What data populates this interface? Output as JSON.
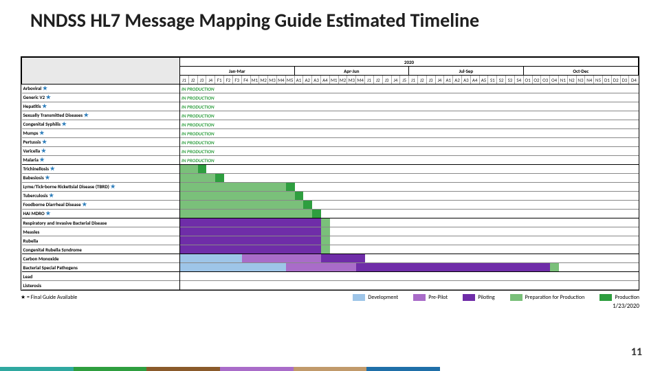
{
  "title": "NNDSS HL7 Message Mapping Guide Estimated Timeline",
  "year_label": "2020",
  "quarters": [
    "Jan-Mar",
    "Apr-Jun",
    "Jul-Sep",
    "Oct-Dec"
  ],
  "weeks": [
    "J1",
    "J2",
    "J3",
    "J4",
    "F1",
    "F2",
    "F3",
    "F4",
    "M1",
    "M2",
    "M3",
    "M4",
    "M5",
    "A1",
    "A2",
    "A3",
    "A4",
    "M1",
    "M2",
    "M3",
    "M4",
    "J1",
    "J2",
    "J3",
    "J4",
    "J5",
    "J1",
    "J2",
    "J3",
    "J4",
    "A1",
    "A2",
    "A3",
    "A4",
    "A5",
    "S1",
    "S2",
    "S3",
    "S4",
    "O1",
    "O2",
    "O3",
    "O4",
    "N1",
    "N2",
    "N3",
    "N4",
    "N5",
    "D1",
    "D2",
    "D3",
    "D4"
  ],
  "star_glyph": "★",
  "in_production_label": "IN PRODUCTION",
  "conditions": [
    {
      "name": "Arboviral",
      "star": true,
      "in_production": true,
      "bars": [],
      "sep": false
    },
    {
      "name": "Generic V2",
      "star": true,
      "in_production": true,
      "bars": [],
      "sep": false
    },
    {
      "name": "Hepatitis",
      "star": true,
      "in_production": true,
      "bars": [],
      "sep": false
    },
    {
      "name": "Sexually Transmitted Diseases",
      "star": true,
      "in_production": true,
      "bars": [],
      "sep": false
    },
    {
      "name": "Congenital Syphilis",
      "star": true,
      "in_production": true,
      "bars": [],
      "sep": false
    },
    {
      "name": "Mumps",
      "star": true,
      "in_production": true,
      "bars": [],
      "sep": false
    },
    {
      "name": "Pertussis",
      "star": true,
      "in_production": true,
      "bars": [],
      "sep": false
    },
    {
      "name": "Varicella",
      "star": true,
      "in_production": true,
      "bars": [],
      "sep": false
    },
    {
      "name": "Malaria",
      "star": true,
      "in_production": true,
      "bars": [],
      "sep": true
    },
    {
      "name": "Trichinellosis",
      "star": true,
      "in_production": false,
      "bars": [
        {
          "phase": "prep",
          "start": 0,
          "end": 2
        },
        {
          "phase": "prod",
          "start": 2,
          "end": 3
        }
      ],
      "sep": false
    },
    {
      "name": "Babesiosis",
      "star": true,
      "in_production": false,
      "bars": [
        {
          "phase": "prep",
          "start": 0,
          "end": 4
        },
        {
          "phase": "prod",
          "start": 4,
          "end": 5
        }
      ],
      "sep": false
    },
    {
      "name": "Lyme/Tick-borne Rickettsial Disease (TBRD)",
      "star": true,
      "in_production": false,
      "bars": [
        {
          "phase": "prep",
          "start": 0,
          "end": 12
        },
        {
          "phase": "prod",
          "start": 12,
          "end": 13
        }
      ],
      "sep": false
    },
    {
      "name": "Tuberculosis",
      "star": true,
      "in_production": false,
      "bars": [
        {
          "phase": "prep",
          "start": 0,
          "end": 13
        },
        {
          "phase": "prod",
          "start": 13,
          "end": 14
        }
      ],
      "sep": false
    },
    {
      "name": "Foodborne Diarrheal Disease",
      "star": true,
      "in_production": false,
      "bars": [
        {
          "phase": "prep",
          "start": 0,
          "end": 14
        },
        {
          "phase": "prod",
          "start": 14,
          "end": 15
        }
      ],
      "sep": false
    },
    {
      "name": "HAI MDRO",
      "star": true,
      "in_production": false,
      "bars": [
        {
          "phase": "prep",
          "start": 0,
          "end": 15
        },
        {
          "phase": "prod",
          "start": 15,
          "end": 16
        }
      ],
      "sep": true
    },
    {
      "name": "Respiratory and Invasive Bacterial Disease",
      "star": false,
      "in_production": false,
      "bars": [
        {
          "phase": "pilot",
          "start": 0,
          "end": 16
        },
        {
          "phase": "prep",
          "start": 16,
          "end": 17
        }
      ],
      "sep": false
    },
    {
      "name": "Measles",
      "star": false,
      "in_production": false,
      "bars": [
        {
          "phase": "pilot",
          "start": 0,
          "end": 16
        },
        {
          "phase": "prep",
          "start": 16,
          "end": 17
        }
      ],
      "sep": false
    },
    {
      "name": "Rubella",
      "star": false,
      "in_production": false,
      "bars": [
        {
          "phase": "pilot",
          "start": 0,
          "end": 16
        },
        {
          "phase": "prep",
          "start": 16,
          "end": 17
        }
      ],
      "sep": false
    },
    {
      "name": "Congenital Rubella Syndrome",
      "star": false,
      "in_production": false,
      "bars": [
        {
          "phase": "pilot",
          "start": 0,
          "end": 16
        },
        {
          "phase": "prep",
          "start": 16,
          "end": 17
        }
      ],
      "sep": true
    },
    {
      "name": "Carbon Monoxide",
      "star": false,
      "in_production": false,
      "bars": [
        {
          "phase": "dev",
          "start": 0,
          "end": 7
        },
        {
          "phase": "pre",
          "start": 7,
          "end": 16
        },
        {
          "phase": "pilot",
          "start": 16,
          "end": 21
        }
      ],
      "sep": false
    },
    {
      "name": "Bacterial Special Pathogens",
      "star": false,
      "in_production": false,
      "bars": [
        {
          "phase": "dev",
          "start": 0,
          "end": 12
        },
        {
          "phase": "pre",
          "start": 12,
          "end": 20
        },
        {
          "phase": "pilot",
          "start": 20,
          "end": 42
        },
        {
          "phase": "prep",
          "start": 42,
          "end": 43
        }
      ],
      "sep": true
    },
    {
      "name": "Lead",
      "star": false,
      "in_production": false,
      "bars": [],
      "sep": false
    },
    {
      "name": "Listerosis",
      "star": false,
      "in_production": false,
      "bars": [],
      "sep": false
    }
  ],
  "legend": {
    "note": "★ = Final Guide Available",
    "items": [
      {
        "label": "Development",
        "cls": "c-dev"
      },
      {
        "label": "Pre-Pilot",
        "cls": "c-pre"
      },
      {
        "label": "Piloting",
        "cls": "c-pilot"
      },
      {
        "label": "Preparation for Production",
        "cls": "c-prep"
      },
      {
        "label": "Production",
        "cls": "c-prod"
      }
    ]
  },
  "as_of_date": "1/23/2020",
  "page_number": "11",
  "footer_colors": [
    "#2fa8a0",
    "#2e9e3f",
    "#8a5a2b",
    "#a96cc9",
    "#c19a6b",
    "#1f6fa8"
  ],
  "chart_data": {
    "type": "gantt",
    "title": "NNDSS HL7 Message Mapping Guide Estimated Timeline",
    "x_unit": "week_of_2020",
    "x_range": [
      0,
      52
    ],
    "phases": [
      "Development",
      "Pre-Pilot",
      "Piloting",
      "Preparation for Production",
      "Production",
      "In Production (prior)"
    ],
    "series": [
      {
        "name": "Arboviral",
        "segments": [
          [
            "In Production (prior)",
            0,
            0
          ]
        ]
      },
      {
        "name": "Generic V2",
        "segments": [
          [
            "In Production (prior)",
            0,
            0
          ]
        ]
      },
      {
        "name": "Hepatitis",
        "segments": [
          [
            "In Production (prior)",
            0,
            0
          ]
        ]
      },
      {
        "name": "Sexually Transmitted Diseases",
        "segments": [
          [
            "In Production (prior)",
            0,
            0
          ]
        ]
      },
      {
        "name": "Congenital Syphilis",
        "segments": [
          [
            "In Production (prior)",
            0,
            0
          ]
        ]
      },
      {
        "name": "Mumps",
        "segments": [
          [
            "In Production (prior)",
            0,
            0
          ]
        ]
      },
      {
        "name": "Pertussis",
        "segments": [
          [
            "In Production (prior)",
            0,
            0
          ]
        ]
      },
      {
        "name": "Varicella",
        "segments": [
          [
            "In Production (prior)",
            0,
            0
          ]
        ]
      },
      {
        "name": "Malaria",
        "segments": [
          [
            "In Production (prior)",
            0,
            0
          ]
        ]
      },
      {
        "name": "Trichinellosis",
        "segments": [
          [
            "Preparation for Production",
            0,
            2
          ],
          [
            "Production",
            2,
            3
          ]
        ]
      },
      {
        "name": "Babesiosis",
        "segments": [
          [
            "Preparation for Production",
            0,
            4
          ],
          [
            "Production",
            4,
            5
          ]
        ]
      },
      {
        "name": "Lyme/Tick-borne Rickettsial Disease (TBRD)",
        "segments": [
          [
            "Preparation for Production",
            0,
            12
          ],
          [
            "Production",
            12,
            13
          ]
        ]
      },
      {
        "name": "Tuberculosis",
        "segments": [
          [
            "Preparation for Production",
            0,
            13
          ],
          [
            "Production",
            13,
            14
          ]
        ]
      },
      {
        "name": "Foodborne Diarrheal Disease",
        "segments": [
          [
            "Preparation for Production",
            0,
            14
          ],
          [
            "Production",
            14,
            15
          ]
        ]
      },
      {
        "name": "HAI MDRO",
        "segments": [
          [
            "Preparation for Production",
            0,
            15
          ],
          [
            "Production",
            15,
            16
          ]
        ]
      },
      {
        "name": "Respiratory and Invasive Bacterial Disease",
        "segments": [
          [
            "Piloting",
            0,
            16
          ],
          [
            "Preparation for Production",
            16,
            17
          ]
        ]
      },
      {
        "name": "Measles",
        "segments": [
          [
            "Piloting",
            0,
            16
          ],
          [
            "Preparation for Production",
            16,
            17
          ]
        ]
      },
      {
        "name": "Rubella",
        "segments": [
          [
            "Piloting",
            0,
            16
          ],
          [
            "Preparation for Production",
            16,
            17
          ]
        ]
      },
      {
        "name": "Congenital Rubella Syndrome",
        "segments": [
          [
            "Piloting",
            0,
            16
          ],
          [
            "Preparation for Production",
            16,
            17
          ]
        ]
      },
      {
        "name": "Carbon Monoxide",
        "segments": [
          [
            "Development",
            0,
            7
          ],
          [
            "Pre-Pilot",
            7,
            16
          ],
          [
            "Piloting",
            16,
            21
          ]
        ]
      },
      {
        "name": "Bacterial Special Pathogens",
        "segments": [
          [
            "Development",
            0,
            12
          ],
          [
            "Pre-Pilot",
            12,
            20
          ],
          [
            "Piloting",
            20,
            42
          ],
          [
            "Preparation for Production",
            42,
            43
          ]
        ]
      },
      {
        "name": "Lead",
        "segments": []
      },
      {
        "name": "Listerosis",
        "segments": []
      }
    ]
  }
}
